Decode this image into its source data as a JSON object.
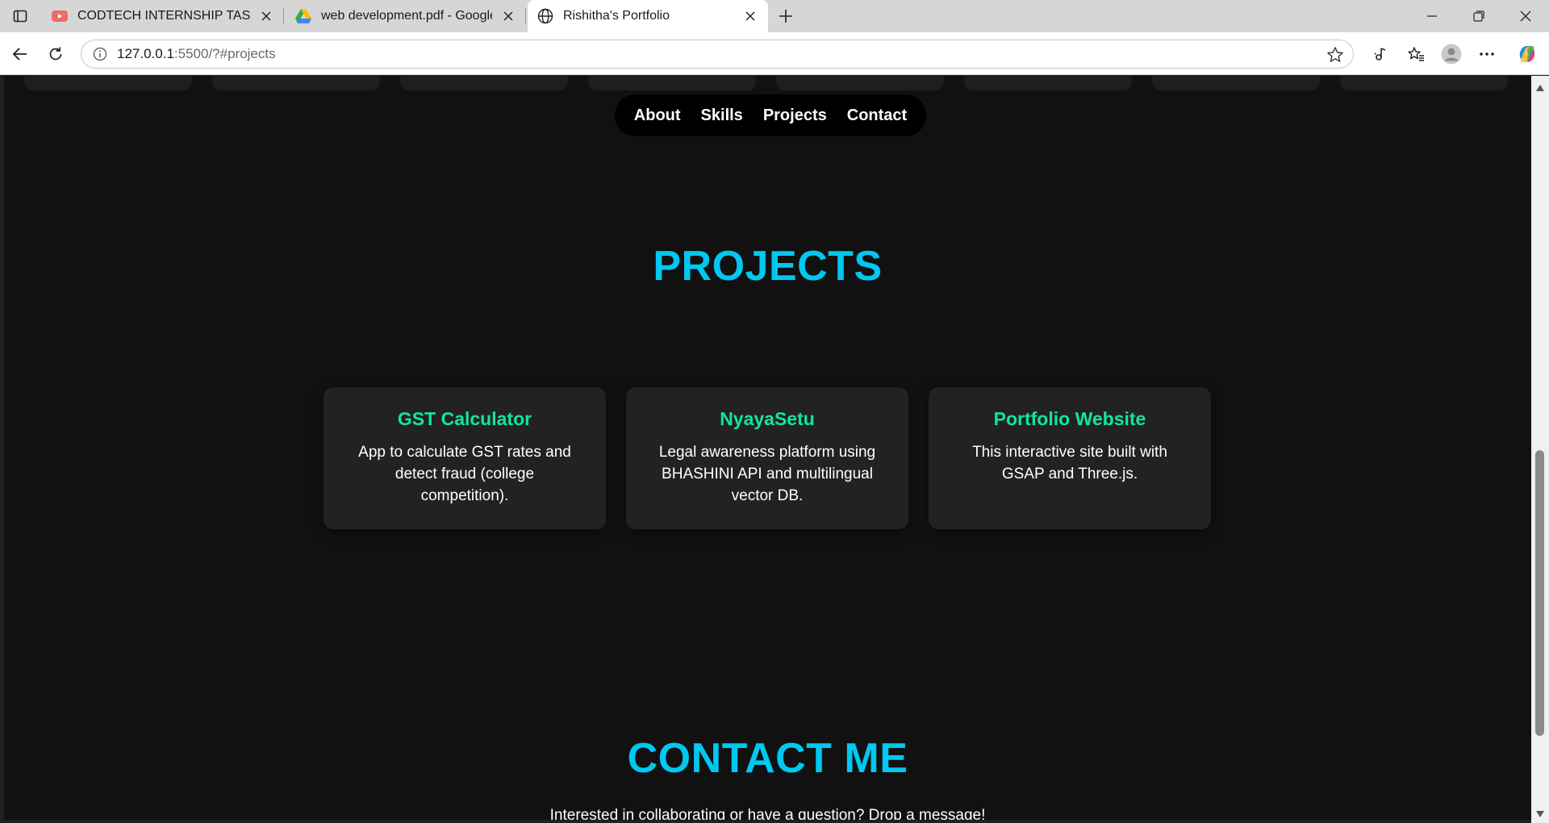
{
  "browser": {
    "tabs": [
      {
        "title": "CODTECH INTERNSHIP TASKS GU",
        "favicon": "youtube-icon",
        "active": false
      },
      {
        "title": "web development.pdf - Google D",
        "favicon": "google-drive-icon",
        "active": false
      },
      {
        "title": "Rishitha's Portfolio",
        "favicon": "globe-icon",
        "active": true
      }
    ],
    "url_host": "127.0.0.1",
    "url_path": ":5500/?#projects",
    "colors": {
      "accent_youtube": "#e53935",
      "tabstrip": "#d6d6d6"
    }
  },
  "page": {
    "nav": [
      "About",
      "Skills",
      "Projects",
      "Contact"
    ],
    "projects_title": "PROJECTS",
    "projects": [
      {
        "name": "GST Calculator",
        "description": "App to calculate GST rates and detect fraud (college competition)."
      },
      {
        "name": "NyayaSetu",
        "description": "Legal awareness platform using BHASHINI API and multilingual vector DB."
      },
      {
        "name": "Portfolio Website",
        "description": "This interactive site built with GSAP and Three.js."
      }
    ],
    "contact_title": "CONTACT ME",
    "contact_subtitle": "Interested in collaborating or have a question? Drop a message!",
    "colors": {
      "heading": "#00c8f0",
      "card_title": "#10e6a0",
      "background": "#111111",
      "card": "#222222"
    }
  }
}
